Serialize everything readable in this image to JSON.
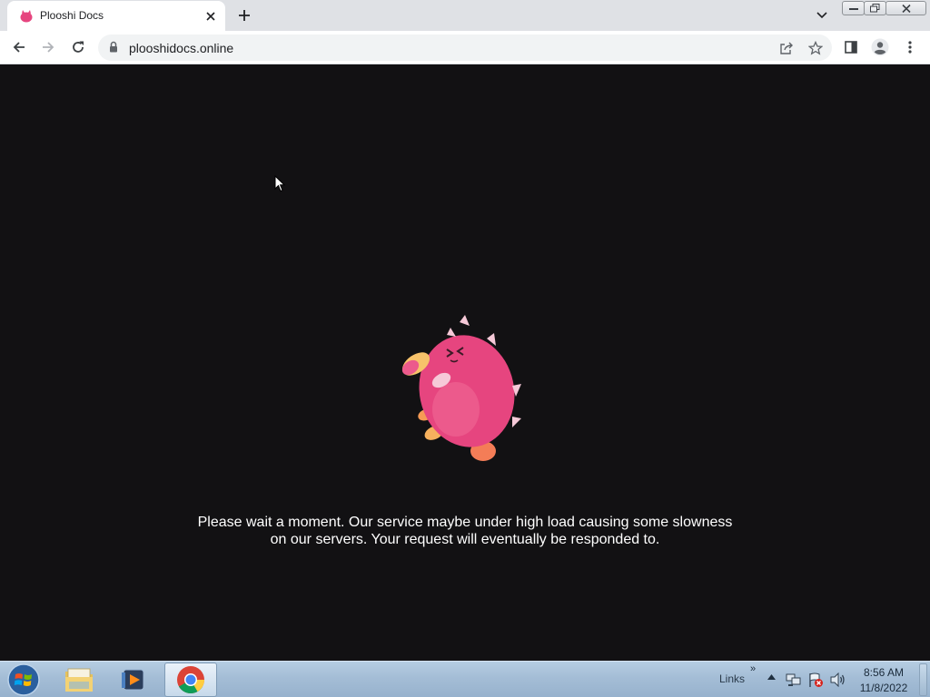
{
  "browser": {
    "tab": {
      "title": "Plooshi Docs"
    },
    "address_bar": {
      "url": "plooshidocs.online"
    }
  },
  "page": {
    "message_line1": "Please wait a moment. Our service maybe under high load causing some slowness",
    "message_line2": "on our servers. Your request will eventually be responded to."
  },
  "taskbar": {
    "links_label": "Links",
    "links_chevron": "»",
    "clock_time": "8:56 AM",
    "clock_date": "11/8/2022"
  },
  "colors": {
    "page_background": "#121113",
    "mascot_pink": "#e6457f",
    "mascot_orange": "#f6905a",
    "tabstrip": "#dfe1e5"
  },
  "icons": [
    "plooshi-favicon-icon",
    "close-icon",
    "plus-icon",
    "chevron-down-icon",
    "back-icon",
    "forward-icon",
    "reload-icon",
    "lock-icon",
    "share-icon",
    "star-icon",
    "side-panel-icon",
    "profile-icon",
    "menu-icon",
    "windows-start-icon",
    "folder-icon",
    "media-player-icon",
    "chrome-icon",
    "network-icon",
    "action-center-flag-icon",
    "speaker-icon"
  ]
}
